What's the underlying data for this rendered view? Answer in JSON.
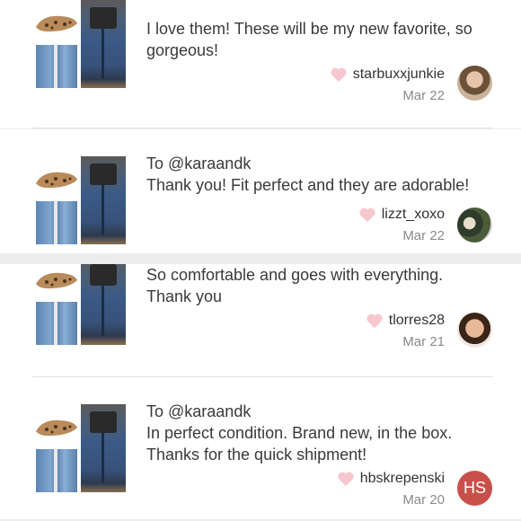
{
  "comments": [
    {
      "to": "",
      "text_lines": [
        "I love them! These will be my new favorite, so",
        "gorgeous!"
      ],
      "username": "starbuxxjunkie",
      "date": "Mar 22",
      "avatar": "photo"
    },
    {
      "to": "To @karaandk",
      "text_lines": [
        "Thank you! Fit perfect and they are adorable!"
      ],
      "username": "lizzt_xoxo",
      "date": "Mar 22",
      "avatar": "photo"
    },
    {
      "to": "",
      "text_lines": [
        "So comfortable and goes with everything.",
        "Thank you"
      ],
      "username": "tlorres28",
      "date": "Mar 21",
      "avatar": "photo"
    },
    {
      "to": "To @karaandk",
      "text_lines": [
        "In perfect condition. Brand new, in the box.",
        "Thanks for the quick shipment!"
      ],
      "username": "hbskrepenski",
      "date": "Mar 20",
      "avatar": "HS"
    }
  ],
  "icons": {
    "like": "heart-icon"
  },
  "colors": {
    "heart": "#f7c7cf",
    "avatar_hs": "#c9504a",
    "date": "#8a8a8a"
  }
}
